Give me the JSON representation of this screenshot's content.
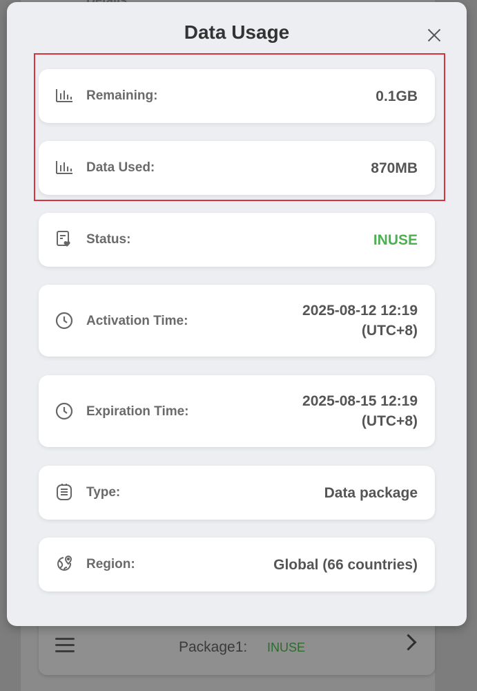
{
  "background": {
    "top_text": "Details",
    "package_label": "Package1:",
    "package_status": "INUSE"
  },
  "modal": {
    "title": "Data Usage",
    "rows": [
      {
        "label": "Remaining:",
        "value": "0.1GB"
      },
      {
        "label": "Data Used:",
        "value": "870MB"
      },
      {
        "label": "Status:",
        "value": "INUSE"
      },
      {
        "label": "Activation Time:",
        "value_line1": "2025-08-12 12:19",
        "value_line2": "(UTC+8)"
      },
      {
        "label": "Expiration Time:",
        "value_line1": "2025-08-15 12:19",
        "value_line2": "(UTC+8)"
      },
      {
        "label": "Type:",
        "value": "Data package"
      },
      {
        "label": "Region:",
        "value": "Global (66 countries)"
      }
    ]
  },
  "colors": {
    "status_green": "#4caf50",
    "highlight_red": "#d7333d"
  },
  "icons": {
    "remaining": "bar-chart-icon",
    "data_used": "bar-chart-icon",
    "status": "document-heart-icon",
    "activation": "clock-icon",
    "expiration": "clock-icon",
    "type": "list-doc-icon",
    "region": "globe-pin-icon"
  }
}
